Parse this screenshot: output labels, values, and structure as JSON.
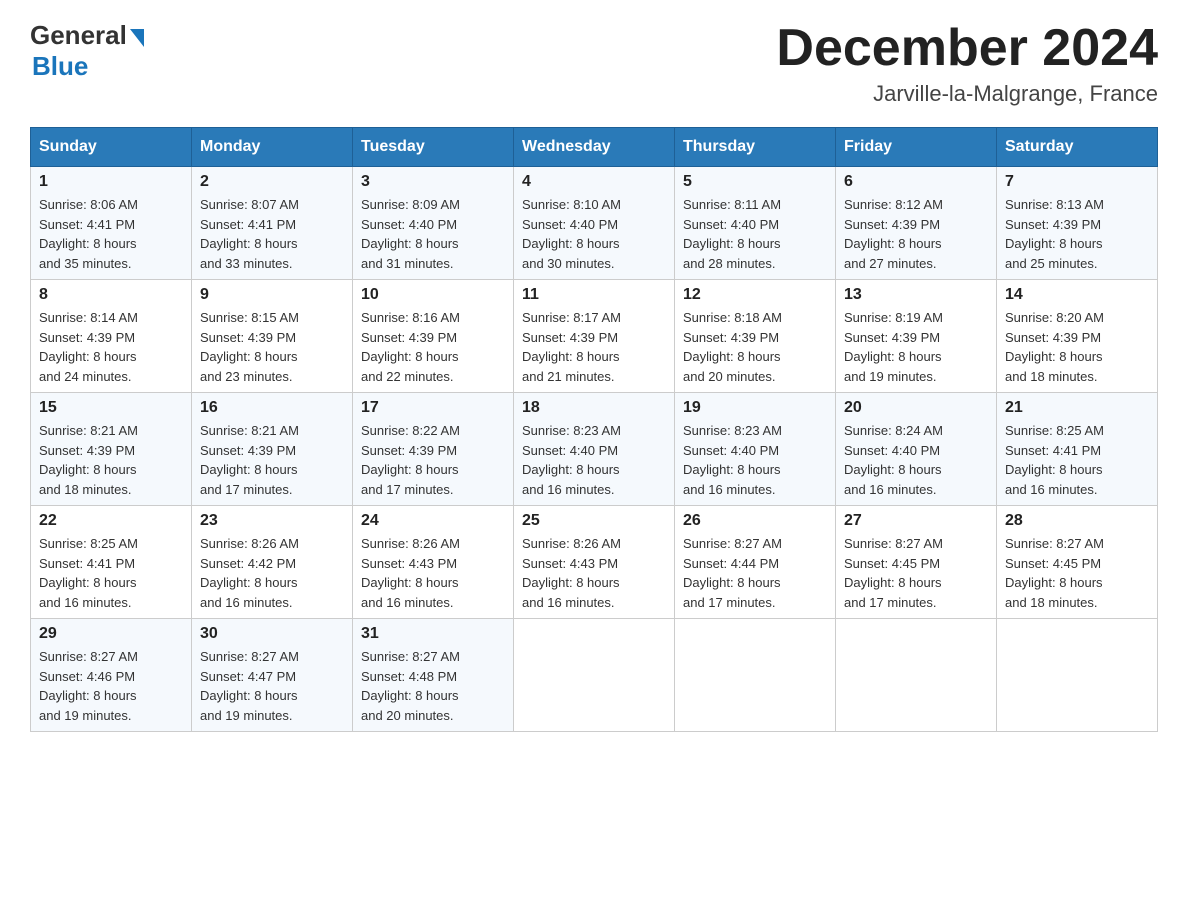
{
  "header": {
    "logo_general": "General",
    "logo_blue": "Blue",
    "month_title": "December 2024",
    "location": "Jarville-la-Malgrange, France"
  },
  "calendar": {
    "days_of_week": [
      "Sunday",
      "Monday",
      "Tuesday",
      "Wednesday",
      "Thursday",
      "Friday",
      "Saturday"
    ],
    "weeks": [
      [
        {
          "day": "1",
          "sunrise": "8:06 AM",
          "sunset": "4:41 PM",
          "daylight": "8 hours and 35 minutes."
        },
        {
          "day": "2",
          "sunrise": "8:07 AM",
          "sunset": "4:41 PM",
          "daylight": "8 hours and 33 minutes."
        },
        {
          "day": "3",
          "sunrise": "8:09 AM",
          "sunset": "4:40 PM",
          "daylight": "8 hours and 31 minutes."
        },
        {
          "day": "4",
          "sunrise": "8:10 AM",
          "sunset": "4:40 PM",
          "daylight": "8 hours and 30 minutes."
        },
        {
          "day": "5",
          "sunrise": "8:11 AM",
          "sunset": "4:40 PM",
          "daylight": "8 hours and 28 minutes."
        },
        {
          "day": "6",
          "sunrise": "8:12 AM",
          "sunset": "4:39 PM",
          "daylight": "8 hours and 27 minutes."
        },
        {
          "day": "7",
          "sunrise": "8:13 AM",
          "sunset": "4:39 PM",
          "daylight": "8 hours and 25 minutes."
        }
      ],
      [
        {
          "day": "8",
          "sunrise": "8:14 AM",
          "sunset": "4:39 PM",
          "daylight": "8 hours and 24 minutes."
        },
        {
          "day": "9",
          "sunrise": "8:15 AM",
          "sunset": "4:39 PM",
          "daylight": "8 hours and 23 minutes."
        },
        {
          "day": "10",
          "sunrise": "8:16 AM",
          "sunset": "4:39 PM",
          "daylight": "8 hours and 22 minutes."
        },
        {
          "day": "11",
          "sunrise": "8:17 AM",
          "sunset": "4:39 PM",
          "daylight": "8 hours and 21 minutes."
        },
        {
          "day": "12",
          "sunrise": "8:18 AM",
          "sunset": "4:39 PM",
          "daylight": "8 hours and 20 minutes."
        },
        {
          "day": "13",
          "sunrise": "8:19 AM",
          "sunset": "4:39 PM",
          "daylight": "8 hours and 19 minutes."
        },
        {
          "day": "14",
          "sunrise": "8:20 AM",
          "sunset": "4:39 PM",
          "daylight": "8 hours and 18 minutes."
        }
      ],
      [
        {
          "day": "15",
          "sunrise": "8:21 AM",
          "sunset": "4:39 PM",
          "daylight": "8 hours and 18 minutes."
        },
        {
          "day": "16",
          "sunrise": "8:21 AM",
          "sunset": "4:39 PM",
          "daylight": "8 hours and 17 minutes."
        },
        {
          "day": "17",
          "sunrise": "8:22 AM",
          "sunset": "4:39 PM",
          "daylight": "8 hours and 17 minutes."
        },
        {
          "day": "18",
          "sunrise": "8:23 AM",
          "sunset": "4:40 PM",
          "daylight": "8 hours and 16 minutes."
        },
        {
          "day": "19",
          "sunrise": "8:23 AM",
          "sunset": "4:40 PM",
          "daylight": "8 hours and 16 minutes."
        },
        {
          "day": "20",
          "sunrise": "8:24 AM",
          "sunset": "4:40 PM",
          "daylight": "8 hours and 16 minutes."
        },
        {
          "day": "21",
          "sunrise": "8:25 AM",
          "sunset": "4:41 PM",
          "daylight": "8 hours and 16 minutes."
        }
      ],
      [
        {
          "day": "22",
          "sunrise": "8:25 AM",
          "sunset": "4:41 PM",
          "daylight": "8 hours and 16 minutes."
        },
        {
          "day": "23",
          "sunrise": "8:26 AM",
          "sunset": "4:42 PM",
          "daylight": "8 hours and 16 minutes."
        },
        {
          "day": "24",
          "sunrise": "8:26 AM",
          "sunset": "4:43 PM",
          "daylight": "8 hours and 16 minutes."
        },
        {
          "day": "25",
          "sunrise": "8:26 AM",
          "sunset": "4:43 PM",
          "daylight": "8 hours and 16 minutes."
        },
        {
          "day": "26",
          "sunrise": "8:27 AM",
          "sunset": "4:44 PM",
          "daylight": "8 hours and 17 minutes."
        },
        {
          "day": "27",
          "sunrise": "8:27 AM",
          "sunset": "4:45 PM",
          "daylight": "8 hours and 17 minutes."
        },
        {
          "day": "28",
          "sunrise": "8:27 AM",
          "sunset": "4:45 PM",
          "daylight": "8 hours and 18 minutes."
        }
      ],
      [
        {
          "day": "29",
          "sunrise": "8:27 AM",
          "sunset": "4:46 PM",
          "daylight": "8 hours and 19 minutes."
        },
        {
          "day": "30",
          "sunrise": "8:27 AM",
          "sunset": "4:47 PM",
          "daylight": "8 hours and 19 minutes."
        },
        {
          "day": "31",
          "sunrise": "8:27 AM",
          "sunset": "4:48 PM",
          "daylight": "8 hours and 20 minutes."
        },
        null,
        null,
        null,
        null
      ]
    ],
    "labels": {
      "sunrise": "Sunrise:",
      "sunset": "Sunset:",
      "daylight": "Daylight:"
    }
  }
}
